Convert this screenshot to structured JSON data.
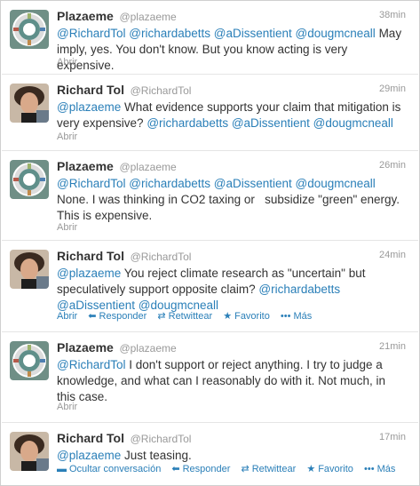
{
  "tweets": [
    {
      "name": "Plazaeme",
      "handle": "@plazaeme",
      "time": "38min",
      "avatar_icon": "wheel-logo-icon",
      "mentions": [
        "@RichardTol",
        "@richardabetts",
        "@aDissentient",
        "@dougmcneall"
      ],
      "text_after": "May imply, yes. You don't know. But you know acting is very expensive.",
      "expand": "Abrir"
    },
    {
      "name": "Richard Tol",
      "handle": "@RichardTol",
      "time": "29min",
      "avatar_icon": "portrait-icon",
      "mentions_lead": [
        "@plazaeme"
      ],
      "text_mid": "What evidence supports your claim that mitigation is very expensive?",
      "mentions_tail": [
        "@richardabetts",
        "@aDissentient",
        "@dougmcneall"
      ],
      "expand": "Abrir"
    },
    {
      "name": "Plazaeme",
      "handle": "@plazaeme",
      "time": "26min",
      "avatar_icon": "wheel-logo-icon",
      "mentions": [
        "@RichardTol",
        "@richardabetts",
        "@aDissentient",
        "@dougmcneall"
      ],
      "text_after": "None. I was thinking in CO2 taxing or   subsidize \"green\" energy. This is expensive.",
      "expand": "Abrir"
    },
    {
      "name": "Richard Tol",
      "handle": "@RichardTol",
      "time": "24min",
      "avatar_icon": "portrait-icon",
      "mentions_lead": [
        "@plazaeme"
      ],
      "text_mid": "You reject climate research as \"uncertain\" but speculatively support opposite claim?",
      "mentions_tail": [
        "@richardabetts",
        "@aDissentient",
        "@dougmcneall"
      ],
      "actions": [
        "Abrir",
        "Responder",
        "Retwittear",
        "Favorito",
        "Más"
      ]
    },
    {
      "name": "Plazaeme",
      "handle": "@plazaeme",
      "time": "21min",
      "avatar_icon": "wheel-logo-icon",
      "mentions": [
        "@RichardTol"
      ],
      "text_after": "I don't support or reject anything. I try to judge a knowledge, and what can I reasonably do with it. Not much, in this case.",
      "expand": "Abrir"
    },
    {
      "name": "Richard Tol",
      "handle": "@RichardTol",
      "time": "17min",
      "avatar_icon": "portrait-icon",
      "mentions_lead": [
        "@plazaeme"
      ],
      "text_mid": "Just teasing.",
      "actions": [
        "Ocultar conversación",
        "Responder",
        "Retwittear",
        "Favorito",
        "Más"
      ]
    }
  ],
  "colors": {
    "link": "#2a7fb8",
    "muted": "#999999",
    "text": "#333333"
  }
}
